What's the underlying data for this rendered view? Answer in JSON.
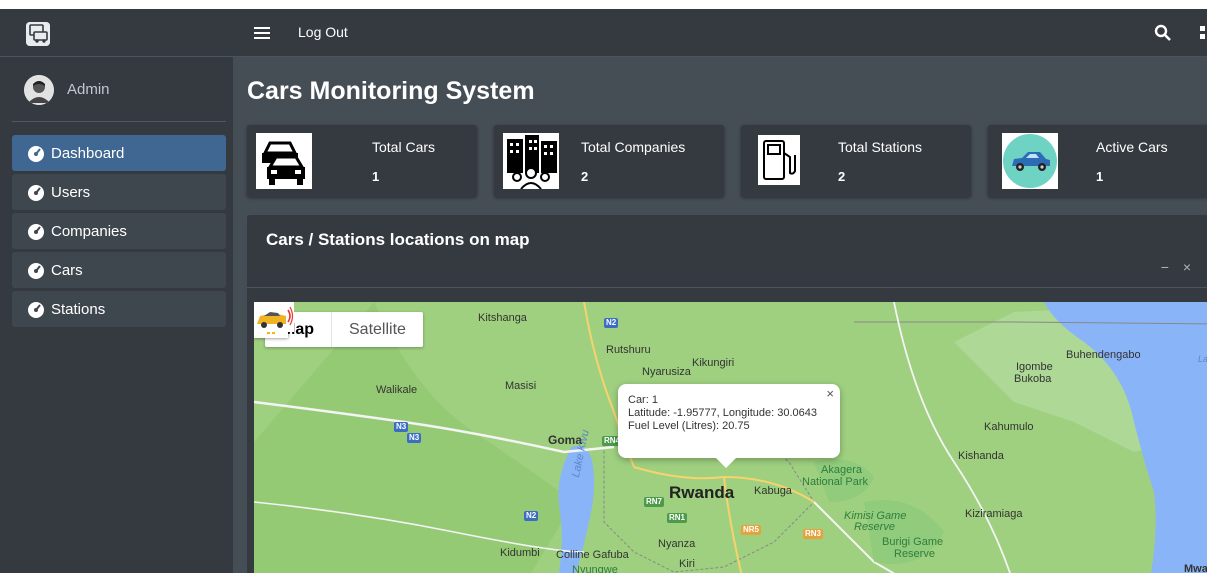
{
  "sidebar": {
    "user_name": "Admin",
    "items": [
      {
        "label": "Dashboard",
        "active": true
      },
      {
        "label": "Users"
      },
      {
        "label": "Companies"
      },
      {
        "label": "Cars"
      },
      {
        "label": "Stations"
      }
    ]
  },
  "header": {
    "logout_label": "Log Out"
  },
  "page": {
    "title": "Cars Monitoring System"
  },
  "stats": [
    {
      "label": "Total Cars",
      "value": "1",
      "icon": "cars-icon"
    },
    {
      "label": "Total Companies",
      "value": "2",
      "icon": "companies-icon"
    },
    {
      "label": "Total Stations",
      "value": "2",
      "icon": "fuel-station-icon"
    },
    {
      "label": "Active Cars",
      "value": "1",
      "icon": "car-icon"
    }
  ],
  "map_card": {
    "title": "Cars / Stations locations on map",
    "collapse_label": "−",
    "remove_label": "×"
  },
  "map": {
    "type_map": "Map",
    "type_satellite": "Satellite",
    "infowindow": {
      "line1": "Car: 1",
      "line2": "Latitude: -1.95777, Longitude: 30.0643",
      "line3": "Fuel Level (Litres): 20.75",
      "close": "×"
    },
    "places": [
      "Kitshanga",
      "Rutshuru",
      "Kikungiri",
      "Nyarusiza",
      "Masisi",
      "Walikale",
      "Goma",
      "Rwanda",
      "Kabuga",
      "Akagera",
      "National Park",
      "Buhendengabo",
      "Igombe",
      "Bukoba",
      "Kahumulo",
      "Kishanda",
      "Kimisi Game",
      "Reserve",
      "Burigi Game",
      "Reserve",
      "Kiziramiaga",
      "Lake Kivu",
      "Nyanza",
      "Kidumbi",
      "Colline Gafuba",
      "Nyungwe",
      "Kiri",
      "Mwa",
      "Lake"
    ],
    "roads": [
      "N2",
      "N3",
      "N3",
      "RN4",
      "RN7",
      "RN1",
      "NR5",
      "RN3",
      "N2"
    ],
    "colors": {
      "land": "#a3d486",
      "water": "#8ab4f8"
    }
  },
  "colors": {
    "sidebar": "#343a40",
    "active": "#3f6791",
    "content": "#454d55"
  }
}
